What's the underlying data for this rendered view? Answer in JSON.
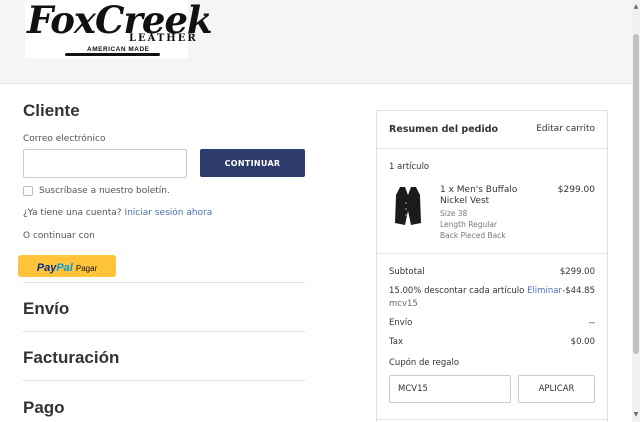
{
  "brand": {
    "logo_main": "FoxCreek",
    "logo_sub": "LEATHER",
    "logo_tagline": "AMERICAN MADE"
  },
  "customer": {
    "heading": "Cliente",
    "email_label": "Correo electrónico",
    "email_value": "",
    "continue_label": "CONTINUAR",
    "newsletter_label": "Suscríbase a nuestro boletín.",
    "account_question": "¿Ya tiene una cuenta?",
    "login_link": "Iniciar sesión ahora",
    "or_continue": "O continuar con",
    "paypal": {
      "part1": "Pay",
      "part2": "Pal",
      "action": "Pagar"
    }
  },
  "sections": {
    "shipping": "Envío",
    "billing": "Facturación",
    "payment": "Pago"
  },
  "summary": {
    "title": "Resumen del pedido",
    "edit_cart": "Editar carrito",
    "item_count": "1 artículo",
    "item": {
      "name_line1": "1 x Men's Buffalo",
      "name_line2": "Nickel Vest",
      "price": "$299.00",
      "options": [
        "Size 38",
        "Length Regular",
        "Back Pieced Back"
      ]
    },
    "subtotal_label": "Subtotal",
    "subtotal_value": "$299.00",
    "discount_label": "15.00% descontar cada artículo",
    "discount_remove": "Eliminar",
    "discount_value": "-$44.85",
    "discount_code": "mcv15",
    "shipping_label": "Envío",
    "shipping_value": "--",
    "tax_label": "Tax",
    "tax_value": "$0.00",
    "coupon_label": "Cupón de regalo",
    "coupon_value": "MCV15",
    "apply_label": "APLICAR"
  },
  "colors": {
    "primary_button": "#2d3c6b",
    "link": "#4a6fb5",
    "paypal_yellow": "#ffc439"
  }
}
